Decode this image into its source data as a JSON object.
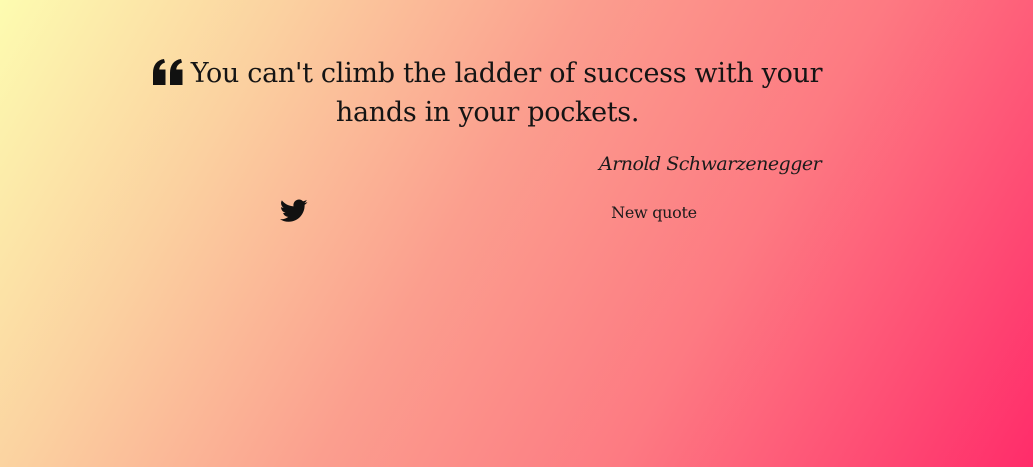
{
  "quote": {
    "text": "You can't climb the ladder of success with your hands in your pockets.",
    "author": "Arnold Schwarzenegger"
  },
  "actions": {
    "new_quote_label": "New quote"
  },
  "icons": {
    "quote": "quote-left-icon",
    "tweet": "twitter-icon"
  },
  "colors": {
    "gradient_start": "#fdfcb0",
    "gradient_end": "#ff2c6a",
    "text": "#111111"
  }
}
